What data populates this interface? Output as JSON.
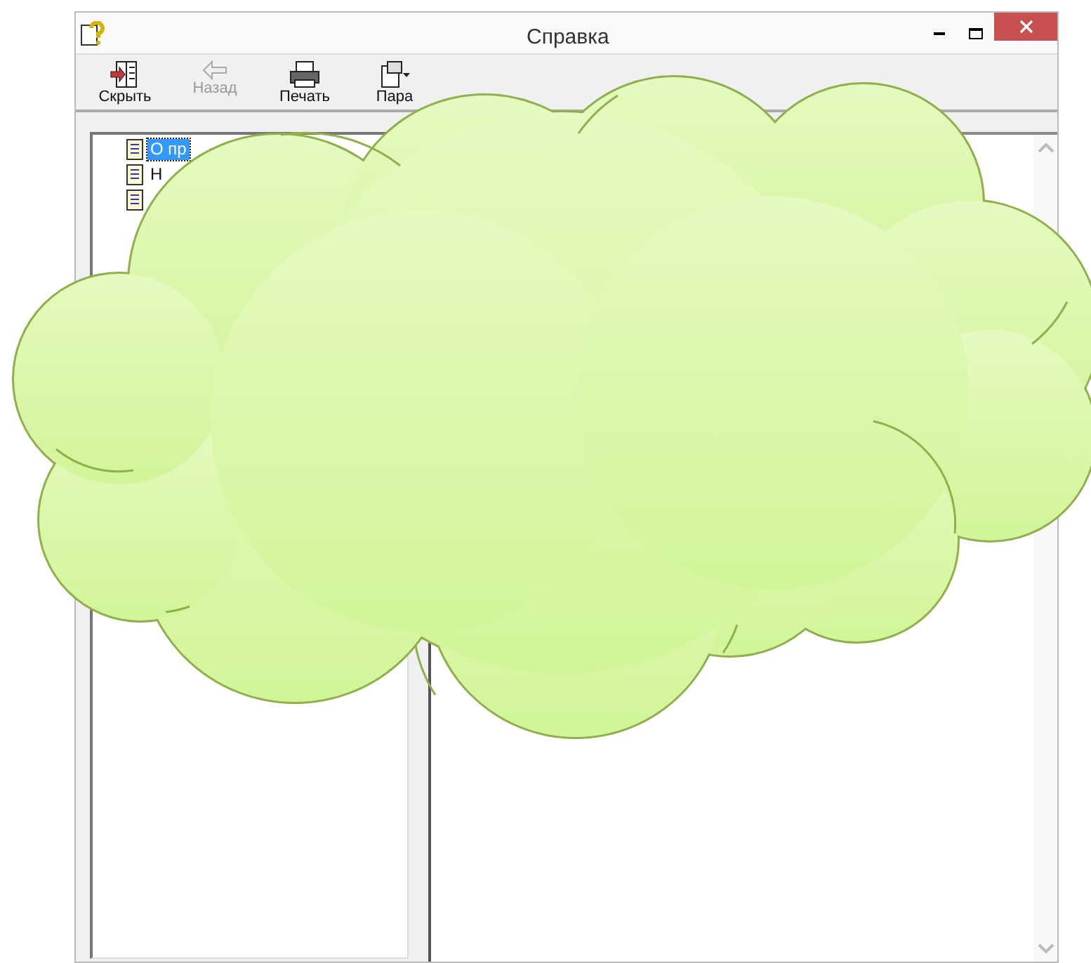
{
  "window": {
    "title": "Справка"
  },
  "toolbar": [
    {
      "kind": "hide",
      "label": "Скрыть",
      "disabled": false
    },
    {
      "kind": "back",
      "label": "Назад",
      "disabled": true
    },
    {
      "kind": "print",
      "label": "Печать",
      "disabled": false
    },
    {
      "kind": "options",
      "label": "Пара",
      "disabled": false
    }
  ],
  "tree": {
    "items": [
      {
        "kind": "page",
        "label": "О пр",
        "selected": true
      },
      {
        "kind": "page",
        "label": "Н",
        "selected": false
      },
      {
        "kind": "page"
      }
    ]
  }
}
